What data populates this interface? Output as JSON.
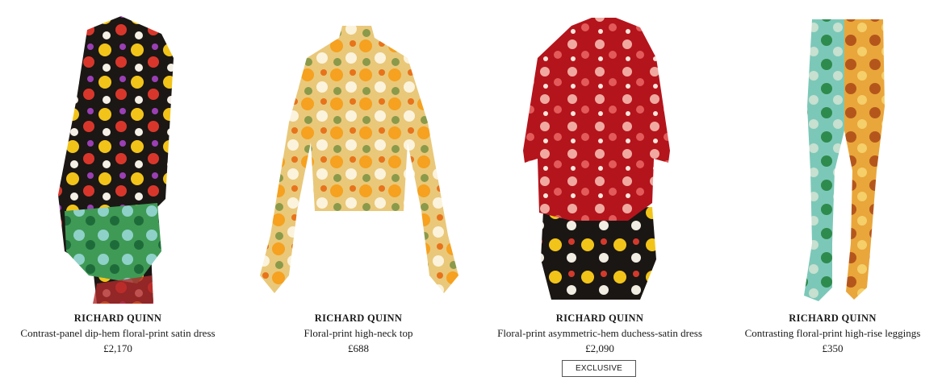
{
  "products": [
    {
      "brand": "RICHARD QUINN",
      "name": "Contrast-panel dip-hem floral-print satin dress",
      "price": "£2,170",
      "image_icon": "dress-image"
    },
    {
      "brand": "RICHARD QUINN",
      "name": "Floral-print high-neck top",
      "price": "£688",
      "image_icon": "top-image"
    },
    {
      "brand": "RICHARD QUINN",
      "name": "Floral-print asymmetric-hem duchess-satin dress",
      "price": "£2,090",
      "badge": "EXCLUSIVE",
      "image_icon": "dress-image"
    },
    {
      "brand": "RICHARD QUINN",
      "name": "Contrasting floral-print high-rise leggings",
      "price": "£350",
      "image_icon": "leggings-image"
    }
  ],
  "colors": {
    "text": "#1a1a1a",
    "badge_border": "#555555"
  }
}
